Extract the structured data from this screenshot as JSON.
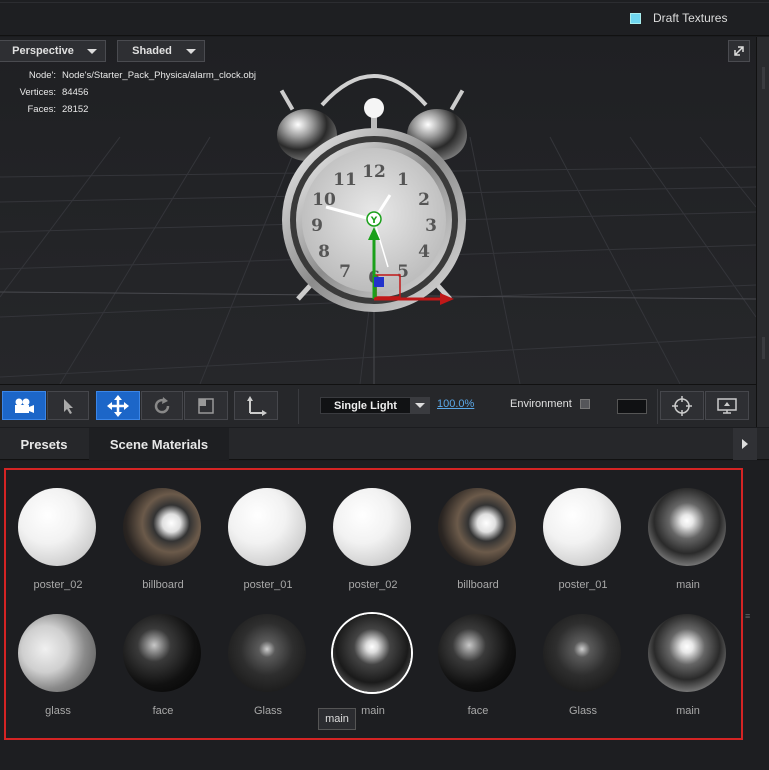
{
  "topbar": {
    "draft_textures_label": "Draft Textures",
    "draft_textures_checked": true
  },
  "viewport": {
    "view_mode": "Perspective",
    "shading_mode": "Shaded",
    "info": [
      {
        "key": "Node':",
        "value": "Node's/Starter_Pack_Physica/alarm_clock.obj"
      },
      {
        "key": "Vertices:",
        "value": "84456"
      },
      {
        "key": "Faces:",
        "value": "28152"
      }
    ],
    "gizmo_label": "Y",
    "clock_numbers": [
      "12",
      "1",
      "2",
      "3",
      "4",
      "5",
      "6",
      "7",
      "8",
      "9",
      "10",
      "11"
    ]
  },
  "toolbar": {
    "light_mode": "Single Light",
    "light_intensity": "100.0%",
    "environment_label": "Environment",
    "environment_checked": false
  },
  "tabs": [
    {
      "label": "Presets",
      "active": false
    },
    {
      "label": "Scene Materials",
      "active": true
    }
  ],
  "materials": [
    {
      "label": "poster_02",
      "style": "white"
    },
    {
      "label": "billboard",
      "style": "billboard"
    },
    {
      "label": "poster_01",
      "style": "white"
    },
    {
      "label": "poster_02",
      "style": "white"
    },
    {
      "label": "billboard",
      "style": "billboard"
    },
    {
      "label": "poster_01",
      "style": "white"
    },
    {
      "label": "main",
      "style": "chrome"
    },
    {
      "label": "glass",
      "style": "glass"
    },
    {
      "label": "face",
      "style": "face"
    },
    {
      "label": "Glass",
      "style": "darkglass"
    },
    {
      "label": "main",
      "style": "chromedark",
      "selected": true
    },
    {
      "label": "face",
      "style": "face"
    },
    {
      "label": "Glass",
      "style": "darkglass"
    },
    {
      "label": "main",
      "style": "chrome"
    }
  ],
  "tooltip": "main",
  "colors": {
    "accent": "#1c66c8",
    "selection_border": "#d42424",
    "link": "#5aa8e8"
  }
}
